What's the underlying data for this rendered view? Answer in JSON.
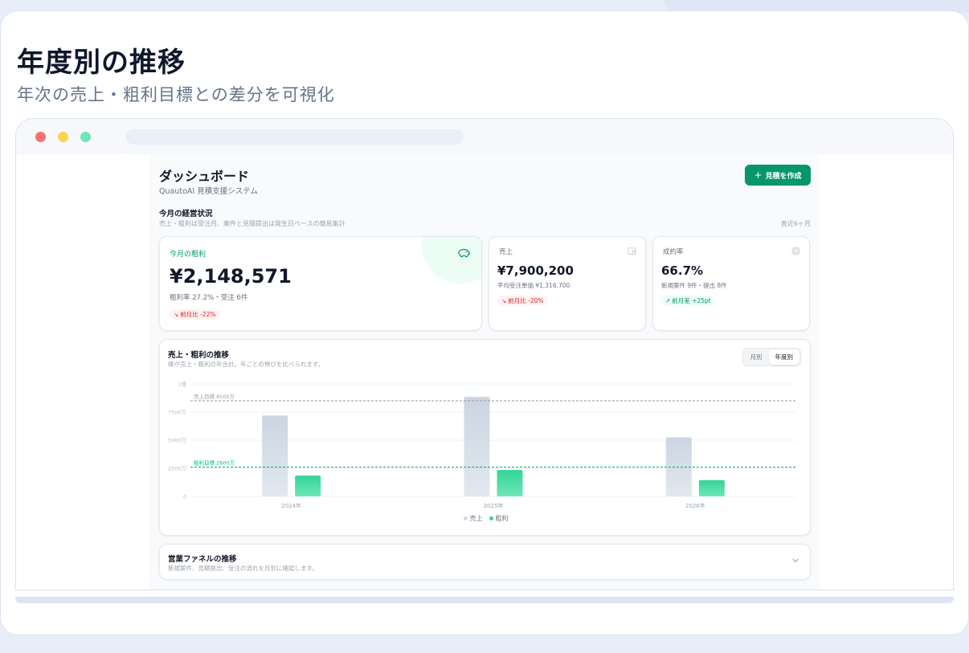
{
  "slide": {
    "title": "年度別の推移",
    "subtitle": "年次の売上・粗利目標との差分を可視化"
  },
  "header": {
    "title": "ダッシュボード",
    "subtitle": "QuautoAI 見積支援システム",
    "new_button": "見積を作成"
  },
  "section": {
    "title": "今月の経営状況",
    "note": "売上・粗利は受注月、案件と見積提出は発生日ベースの簡易集計",
    "range": "直近6ヶ月"
  },
  "kpis": {
    "gross_profit": {
      "label": "今月の粗利",
      "value": "¥2,148,571",
      "detail": "粗利率 27.2%・受注 6件",
      "badge": "前月比 -22%",
      "icon": "piggy-bank-icon"
    },
    "sales": {
      "label": "売上",
      "value": "¥7,900,200",
      "detail": "平均受注単価 ¥1,316,700",
      "badge": "前月比 -20%",
      "icon": "wallet-icon"
    },
    "win_rate": {
      "label": "成約率",
      "value": "66.7%",
      "detail": "新規案件 9件・提出 8件",
      "badge": "前月差 +25pt",
      "icon": "target-icon"
    }
  },
  "chart_card": {
    "title": "売上・粗利の推移",
    "note": "棒が売上・粗利の年合計。年ごとの伸びを比べられます。",
    "toggle": [
      "月別",
      "年度別"
    ],
    "active_toggle": "年度別"
  },
  "chart_data": {
    "type": "bar",
    "categories": [
      "2024年",
      "2025年",
      "2026年"
    ],
    "series": [
      {
        "name": "売上",
        "values": [
          7200,
          8850,
          5250
        ],
        "color": "#cfd8e3"
      },
      {
        "name": "粗利",
        "values": [
          1850,
          2350,
          1450
        ],
        "color": "#34d399"
      }
    ],
    "ylim": [
      0,
      10000
    ],
    "yticks": [
      {
        "value": 0,
        "label": "0"
      },
      {
        "value": 2500,
        "label": "2500万"
      },
      {
        "value": 5000,
        "label": "5000万"
      },
      {
        "value": 7500,
        "label": "7500万"
      },
      {
        "value": 10000,
        "label": "1億"
      }
    ],
    "targets": [
      {
        "label": "売上目標 8500万",
        "value": 8500,
        "color": "#a78bab"
      },
      {
        "label": "粗利目標 2600万",
        "value": 2600,
        "color": "#10b981"
      }
    ],
    "grid": true,
    "legend": "bottom-center"
  },
  "funnel": {
    "title": "営業ファネルの推移",
    "note": "新規案件、見積提出、受注の流れを月別に確認します。"
  }
}
